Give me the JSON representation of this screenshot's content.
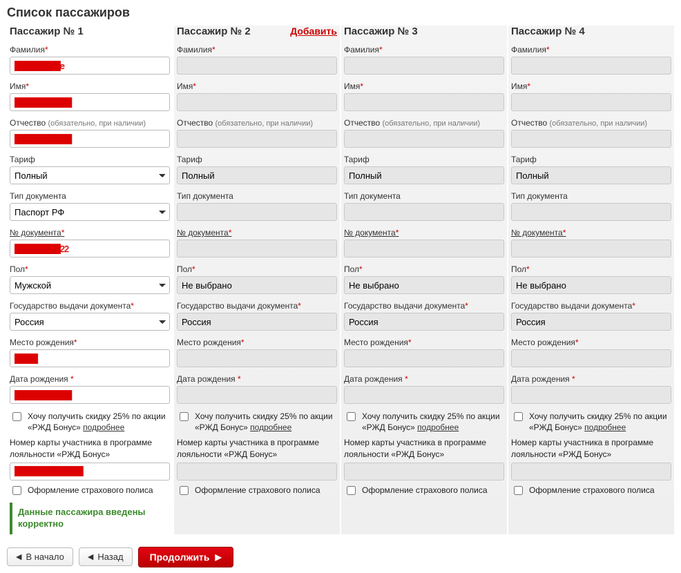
{
  "title": "Список пассажиров",
  "addLabel": "Добавить",
  "labels": {
    "lastName": "Фамилия",
    "firstName": "Имя",
    "middleName": "Отчество",
    "middleNameHint": "(обязательно, при наличии)",
    "tariff": "Тариф",
    "docType": "Тип документа",
    "docNum": "№ документа",
    "gender": "Пол",
    "issueCountry": "Государство выдачи документа",
    "birthPlace": "Место рождения",
    "birthDate": "Дата рождения",
    "bonusCheckbox": "Хочу получить скидку 25% по акции «РЖД Бонус»",
    "bonusMore": "подробнее",
    "bonusCardLabel": "Номер карты участника в программе лояльности «РЖД Бонус»",
    "insurance": "Оформление страхового полиса",
    "validMessage": "Данные пассажира введены корректно",
    "navStart": "В начало",
    "navBack": "Назад",
    "navContinue": "Продолжить"
  },
  "passengers": [
    {
      "title": "Пассажир № 1",
      "active": true,
      "showAdd": false,
      "showValid": true,
      "values": {
        "lastName": "████████е",
        "firstName": "██████████",
        "middleName": "██████████",
        "tariff": "Полный",
        "docType": "Паспорт РФ",
        "docNum": "████████22",
        "gender": "Мужской",
        "issueCountry": "Россия",
        "birthPlace": "████",
        "birthDate": "██████████",
        "bonusCard": "████████████"
      }
    },
    {
      "title": "Пассажир № 2",
      "active": false,
      "showAdd": true,
      "showValid": false,
      "values": {
        "lastName": "",
        "firstName": "",
        "middleName": "",
        "tariff": "Полный",
        "docType": "",
        "docNum": "",
        "gender": "Не выбрано",
        "issueCountry": "Россия",
        "birthPlace": "",
        "birthDate": "",
        "bonusCard": ""
      }
    },
    {
      "title": "Пассажир № 3",
      "active": false,
      "showAdd": false,
      "showValid": false,
      "values": {
        "lastName": "",
        "firstName": "",
        "middleName": "",
        "tariff": "Полный",
        "docType": "",
        "docNum": "",
        "gender": "Не выбрано",
        "issueCountry": "Россия",
        "birthPlace": "",
        "birthDate": "",
        "bonusCard": ""
      }
    },
    {
      "title": "Пассажир № 4",
      "active": false,
      "showAdd": false,
      "showValid": false,
      "values": {
        "lastName": "",
        "firstName": "",
        "middleName": "",
        "tariff": "Полный",
        "docType": "",
        "docNum": "",
        "gender": "Не выбрано",
        "issueCountry": "Россия",
        "birthPlace": "",
        "birthDate": "",
        "bonusCard": ""
      }
    }
  ]
}
